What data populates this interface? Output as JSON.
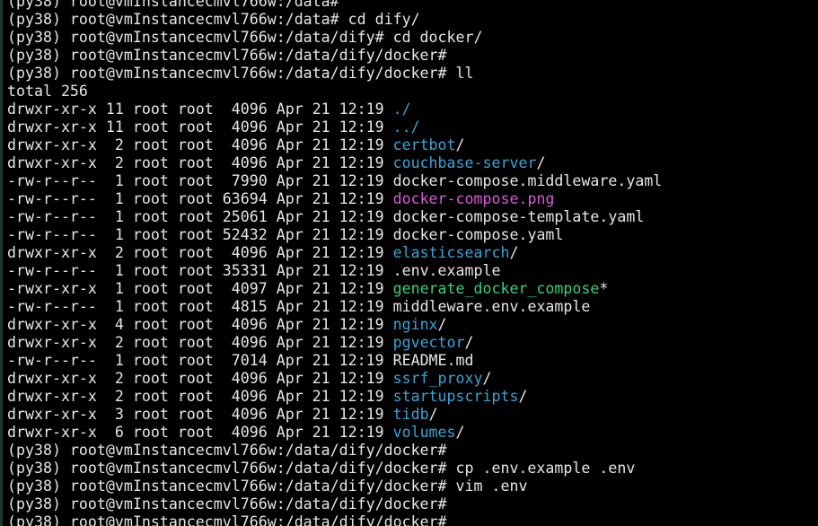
{
  "colors": {
    "background": "#000000",
    "text": "#e6e6e6",
    "directory": "#3aa3d6",
    "image": "#d65bd6",
    "executable": "#36d07a"
  },
  "terminal": {
    "lines": [
      {
        "type": "prompt",
        "text": "(py38) root@vmInstancecmvl766w:/data#"
      },
      {
        "type": "prompt",
        "text": "(py38) root@vmInstancecmvl766w:/data# cd dify/"
      },
      {
        "type": "prompt",
        "text": "(py38) root@vmInstancecmvl766w:/data/dify# cd docker/"
      },
      {
        "type": "prompt",
        "text": "(py38) root@vmInstancecmvl766w:/data/dify/docker#"
      },
      {
        "type": "prompt",
        "text": "(py38) root@vmInstancecmvl766w:/data/dify/docker# ll"
      },
      {
        "type": "text",
        "text": "total 256"
      },
      {
        "type": "entry",
        "perms": "drwxr-xr-x 11 root root  4096 Apr 21 12:19 ",
        "name": "./",
        "kind": "dir",
        "suffix": ""
      },
      {
        "type": "entry",
        "perms": "drwxr-xr-x 11 root root  4096 Apr 21 12:19 ",
        "name": "../",
        "kind": "dir",
        "suffix": ""
      },
      {
        "type": "entry",
        "perms": "drwxr-xr-x  2 root root  4096 Apr 21 12:19 ",
        "name": "certbot",
        "kind": "dir",
        "suffix": "/"
      },
      {
        "type": "entry",
        "perms": "drwxr-xr-x  2 root root  4096 Apr 21 12:19 ",
        "name": "couchbase-server",
        "kind": "dir",
        "suffix": "/"
      },
      {
        "type": "entry",
        "perms": "-rw-r--r--  1 root root  7990 Apr 21 12:19 ",
        "name": "docker-compose.middleware.yaml",
        "kind": "plain",
        "suffix": ""
      },
      {
        "type": "entry",
        "perms": "-rw-r--r--  1 root root 63694 Apr 21 12:19 ",
        "name": "docker-compose.png",
        "kind": "img",
        "suffix": ""
      },
      {
        "type": "entry",
        "perms": "-rw-r--r--  1 root root 25061 Apr 21 12:19 ",
        "name": "docker-compose-template.yaml",
        "kind": "plain",
        "suffix": ""
      },
      {
        "type": "entry",
        "perms": "-rw-r--r--  1 root root 52432 Apr 21 12:19 ",
        "name": "docker-compose.yaml",
        "kind": "plain",
        "suffix": ""
      },
      {
        "type": "entry",
        "perms": "drwxr-xr-x  2 root root  4096 Apr 21 12:19 ",
        "name": "elasticsearch",
        "kind": "dir",
        "suffix": "/"
      },
      {
        "type": "entry",
        "perms": "-rw-r--r--  1 root root 35331 Apr 21 12:19 ",
        "name": ".env.example",
        "kind": "plain",
        "suffix": ""
      },
      {
        "type": "entry",
        "perms": "-rwxr-xr-x  1 root root  4097 Apr 21 12:19 ",
        "name": "generate_docker_compose",
        "kind": "exe",
        "suffix": "*"
      },
      {
        "type": "entry",
        "perms": "-rw-r--r--  1 root root  4815 Apr 21 12:19 ",
        "name": "middleware.env.example",
        "kind": "plain",
        "suffix": ""
      },
      {
        "type": "entry",
        "perms": "drwxr-xr-x  4 root root  4096 Apr 21 12:19 ",
        "name": "nginx",
        "kind": "dir",
        "suffix": "/"
      },
      {
        "type": "entry",
        "perms": "drwxr-xr-x  2 root root  4096 Apr 21 12:19 ",
        "name": "pgvector",
        "kind": "dir",
        "suffix": "/"
      },
      {
        "type": "entry",
        "perms": "-rw-r--r--  1 root root  7014 Apr 21 12:19 ",
        "name": "README.md",
        "kind": "plain",
        "suffix": ""
      },
      {
        "type": "entry",
        "perms": "drwxr-xr-x  2 root root  4096 Apr 21 12:19 ",
        "name": "ssrf_proxy",
        "kind": "dir",
        "suffix": "/"
      },
      {
        "type": "entry",
        "perms": "drwxr-xr-x  2 root root  4096 Apr 21 12:19 ",
        "name": "startupscripts",
        "kind": "dir",
        "suffix": "/"
      },
      {
        "type": "entry",
        "perms": "drwxr-xr-x  3 root root  4096 Apr 21 12:19 ",
        "name": "tidb",
        "kind": "dir",
        "suffix": "/"
      },
      {
        "type": "entry",
        "perms": "drwxr-xr-x  6 root root  4096 Apr 21 12:19 ",
        "name": "volumes",
        "kind": "dir",
        "suffix": "/"
      },
      {
        "type": "prompt",
        "text": "(py38) root@vmInstancecmvl766w:/data/dify/docker#"
      },
      {
        "type": "prompt",
        "text": "(py38) root@vmInstancecmvl766w:/data/dify/docker# cp .env.example .env"
      },
      {
        "type": "prompt",
        "text": "(py38) root@vmInstancecmvl766w:/data/dify/docker# vim .env"
      },
      {
        "type": "prompt",
        "text": "(py38) root@vmInstancecmvl766w:/data/dify/docker#"
      },
      {
        "type": "prompt",
        "text": "(py38) root@vmInstancecmvl766w:/data/dify/docker#"
      }
    ]
  }
}
